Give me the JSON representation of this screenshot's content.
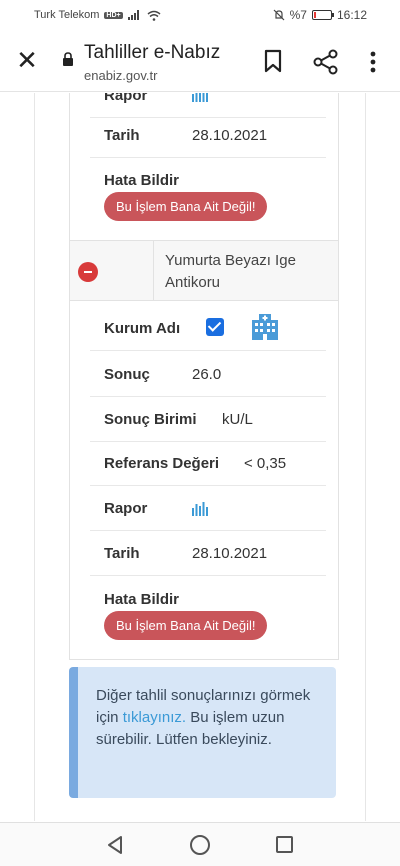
{
  "status_bar": {
    "carrier": "Turk Telekom",
    "network_badge": "HD+",
    "battery_text": "%7",
    "battery_level": 0.07,
    "time": "16:12"
  },
  "header": {
    "title": "Tahliller e-Nabız",
    "url": "enabiz.gov.tr"
  },
  "icons": {
    "close": "close-icon",
    "lock": "lock-icon",
    "bookmark": "bookmark-icon",
    "share": "share-icon",
    "menu": "more-vert-icon",
    "rapor": "bar-chart-icon",
    "building": "hospital-building-icon",
    "remove": "minus-circle-icon"
  },
  "colors": {
    "error_button": "#c9555a",
    "checkbox": "#1a6ee0",
    "info_bg": "#d7e6f7",
    "info_border": "#7aaae0",
    "link": "#3b9ad6",
    "remove": "#d83a3a"
  },
  "previous_result": {
    "rapor_label": "Rapor",
    "tarih_label": "Tarih",
    "tarih_value": "28.10.2021",
    "error_label": "Hata Bildir",
    "error_button": "Bu İşlem Bana Ait Değil!"
  },
  "test": {
    "name": "Yumurta Beyazı Ige Antikoru",
    "fields": {
      "kurum_label": "Kurum Adı",
      "kurum_checked": true,
      "sonuc_label": "Sonuç",
      "sonuc_value": "26.0",
      "birim_label": "Sonuç Birimi",
      "birim_value": "kU/L",
      "referans_label": "Referans Değeri",
      "referans_value": "< 0,35",
      "rapor_label": "Rapor",
      "tarih_label": "Tarih",
      "tarih_value": "28.10.2021",
      "error_label": "Hata Bildir",
      "error_button": "Bu İşlem Bana Ait Değil!"
    }
  },
  "info": {
    "text_before": "Diğer tahlil sonuçlarınızı görmek için ",
    "link": "tıklayınız.",
    "text_after": " Bu işlem uzun sürebilir. Lütfen bekleyiniz."
  }
}
